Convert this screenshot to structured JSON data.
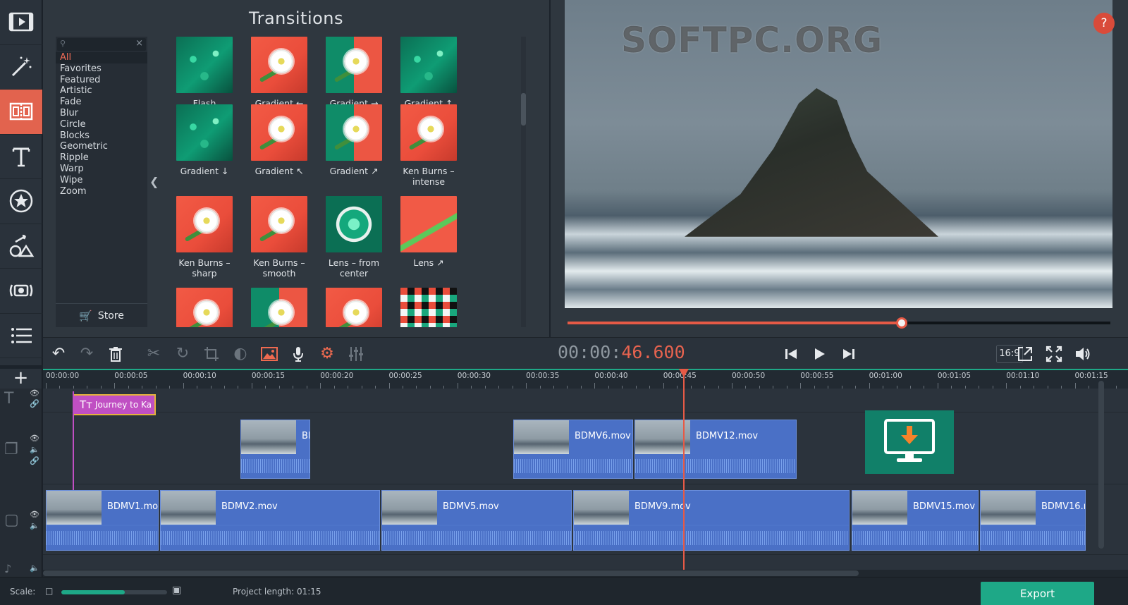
{
  "panel": {
    "title": "Transitions",
    "categories": [
      "All",
      "Favorites",
      "Featured",
      "Artistic",
      "Fade",
      "Blur",
      "Circle",
      "Blocks",
      "Geometric",
      "Ripple",
      "Warp",
      "Wipe",
      "Zoom"
    ],
    "selected_category": "All",
    "store_label": "Store",
    "transitions": [
      {
        "label": "Flash",
        "style": "g"
      },
      {
        "label": "Gradient ←",
        "style": "r"
      },
      {
        "label": "Gradient →",
        "style": "half"
      },
      {
        "label": "Gradient ↑",
        "style": "g"
      },
      {
        "label": "Gradient ↓",
        "style": "g"
      },
      {
        "label": "Gradient ↖",
        "style": "r"
      },
      {
        "label": "Gradient ↗",
        "style": "half"
      },
      {
        "label": "Ken Burns – intense",
        "style": "r"
      },
      {
        "label": "Ken Burns – sharp",
        "style": "r"
      },
      {
        "label": "Ken Burns – smooth",
        "style": "r"
      },
      {
        "label": "Lens – from center",
        "style": "lens"
      },
      {
        "label": "Lens ↗",
        "style": "lens2"
      },
      {
        "label": "",
        "style": "r"
      },
      {
        "label": "",
        "style": "half"
      },
      {
        "label": "",
        "style": "r"
      },
      {
        "label": "",
        "style": "tiles"
      }
    ]
  },
  "preview": {
    "watermark": "SOFTPC.ORG",
    "help": "?",
    "progress_fraction": 0.615
  },
  "toolbar": {
    "timecode_dim": "00:00:",
    "timecode_hl": "46.600",
    "aspect": "16:9"
  },
  "timeline": {
    "ruler": [
      "00:00:00",
      "00:00:05",
      "00:00:10",
      "00:00:15",
      "00:00:20",
      "00:00:25",
      "00:00:30",
      "00:00:35",
      "00:00:40",
      "00:00:45",
      "00:00:50",
      "00:00:55",
      "00:01:00",
      "00:01:05",
      "00:01:10",
      "00:01:15"
    ],
    "title_clip": "Journey to Ka",
    "overlay_clips": [
      "Bl",
      "BDMV6.mov",
      "BDMV12.mov"
    ],
    "main_clips": [
      "BDMV1.mov",
      "BDMV2.mov",
      "BDMV5.mov",
      "BDMV9.mov",
      "BDMV15.mov",
      "BDMV16.m"
    ]
  },
  "footer": {
    "scale_label": "Scale:",
    "project_length": "Project length:  01:15",
    "scale_fraction": 0.6,
    "export_label": "Export"
  }
}
